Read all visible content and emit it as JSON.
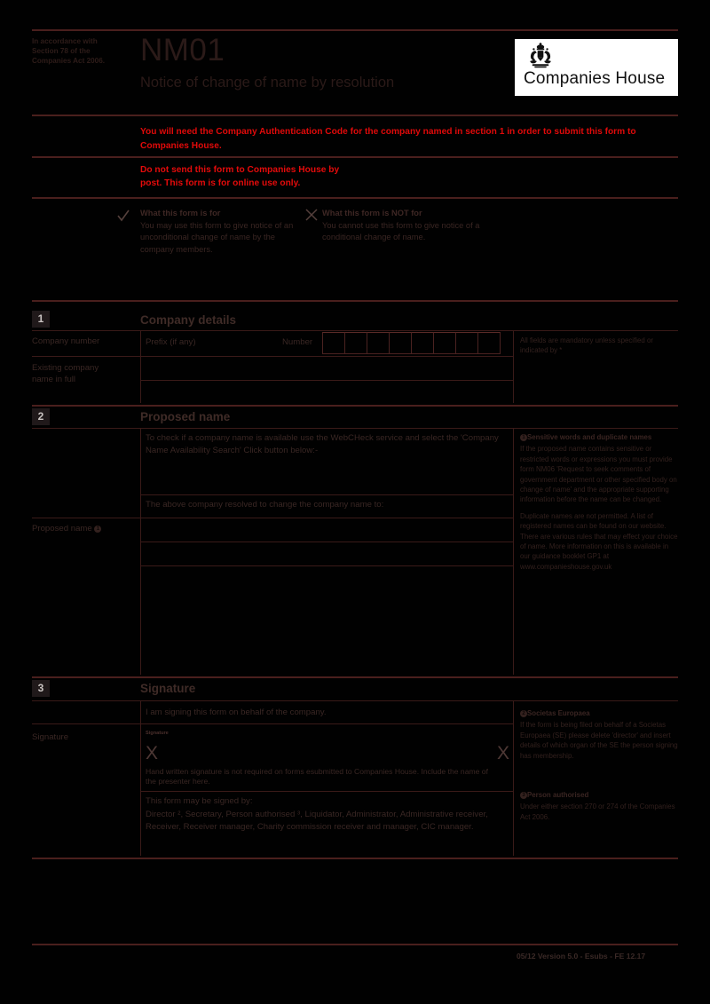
{
  "header": {
    "accordance": "In accordance with\nSection 78 of the\nCompanies Act 2006.",
    "form_code": "NM01",
    "form_title": "Notice of change of name by resolution",
    "logo_text": "Companies House",
    "logo_crest": "royal-coat-of-arms-icon"
  },
  "warnings": {
    "auth_code": "You will need the Company Authentication Code for the company named in section 1 in order to submit this form to Companies House.",
    "no_post": "Do not send this form to Companies House by\npost. This form is for online use only.",
    "color": "#e00a0a"
  },
  "purpose": {
    "for": {
      "icon": "check-icon",
      "heading": "What this form is for",
      "body": "You may use this form to give notice of an unconditional change of name by the company members."
    },
    "not_for": {
      "icon": "cross-icon",
      "heading": "What this form is NOT for",
      "body": "You cannot use this form to give notice of a conditional change of name."
    }
  },
  "sections": {
    "one": {
      "number": "1",
      "title": "Company details",
      "company_number_label": "Company number",
      "prefix_label": "Prefix (if any)",
      "number_label": "Number",
      "number_boxes": 8,
      "existing_name_label": "Existing company\nname in full",
      "note": "All fields are mandatory unless specified or indicated by *"
    },
    "two": {
      "number": "2",
      "title": "Proposed name",
      "webcheck_text": "To check if a company name is available use the WebCHeck service and select the 'Company Name Availability Search' Click button below:-",
      "resolved_text": "The above company resolved to change the company name to:",
      "proposed_name_label": "Proposed name",
      "proposed_name_sup": "1",
      "note_sup": "1",
      "note_heading": "Sensitive words and duplicate names",
      "note_body_1": " If the proposed name contains sensitive or restricted words or expressions you must provide form NM06 'Request to seek comments of government department or other specified body on change of name' and the appropriate supporting information before the name can be changed.",
      "note_body_2": "Duplicate names are not permitted. A list of registered names can be found on our website. There are various rules that may effect your choice of name. More information on this is available in our guidance booklet GP1  at www.companieshouse.gov.uk"
    },
    "three": {
      "number": "3",
      "title": "Signature",
      "behalf_text": "I am signing this form on behalf of the company.",
      "signature_label": "Signature",
      "signature_mini_label": "Signature",
      "signature_mark": "X",
      "handwritten_note": "Hand written signature is not required on forms esubmitted to Companies House. Include the name of the presenter here.",
      "signed_by_heading": "This form may be signed by:",
      "signed_by_body": "Director ², Secretary, Person authorised ³, Liquidator, Administrator, Administrative receiver, Receiver, Receiver manager, Charity commission receiver and manager, CIC manager.",
      "note_2_sup": "2",
      "note_2_heading": "Societas Europaea",
      "note_2_body": "If the form is being filed on behalf of a Societas Europaea (SE) please delete 'director' and insert details of which organ of the SE the person signing has membership.",
      "note_3_sup": "3",
      "note_3_heading": "Person authorised",
      "note_3_body": "Under either section 270 or 274 of the Companies Act 2006."
    }
  },
  "footer": {
    "text": "05/12 Version 5.0 - Esubs - FE 12.17"
  }
}
